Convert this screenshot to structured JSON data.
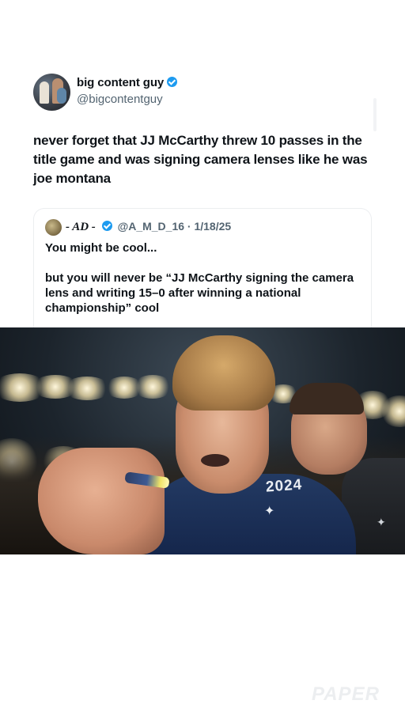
{
  "author": {
    "display_name": "big content guy",
    "handle": "@bigcontentguy",
    "verified": true
  },
  "tweet": {
    "text": "never forget that JJ McCarthy threw 10 passes in the title game and was signing camera lenses like he was joe montana"
  },
  "quoted_tweet": {
    "display_name": "- AD -",
    "handle_and_date": "@A_M_D_16 · 1/18/25",
    "verified": true,
    "text": "You might be cool...\n\nbut you will never be “JJ McCarthy signing the camera lens and writing 15–0 after winning a national championship” cool"
  },
  "media": {
    "jersey_text": "2024",
    "logo_glyph": "✦",
    "accent_colors": {
      "jersey": "#14254a",
      "stadium": "#1c242c",
      "verified": "#1d9bf0"
    }
  },
  "watermark": "PAPER"
}
